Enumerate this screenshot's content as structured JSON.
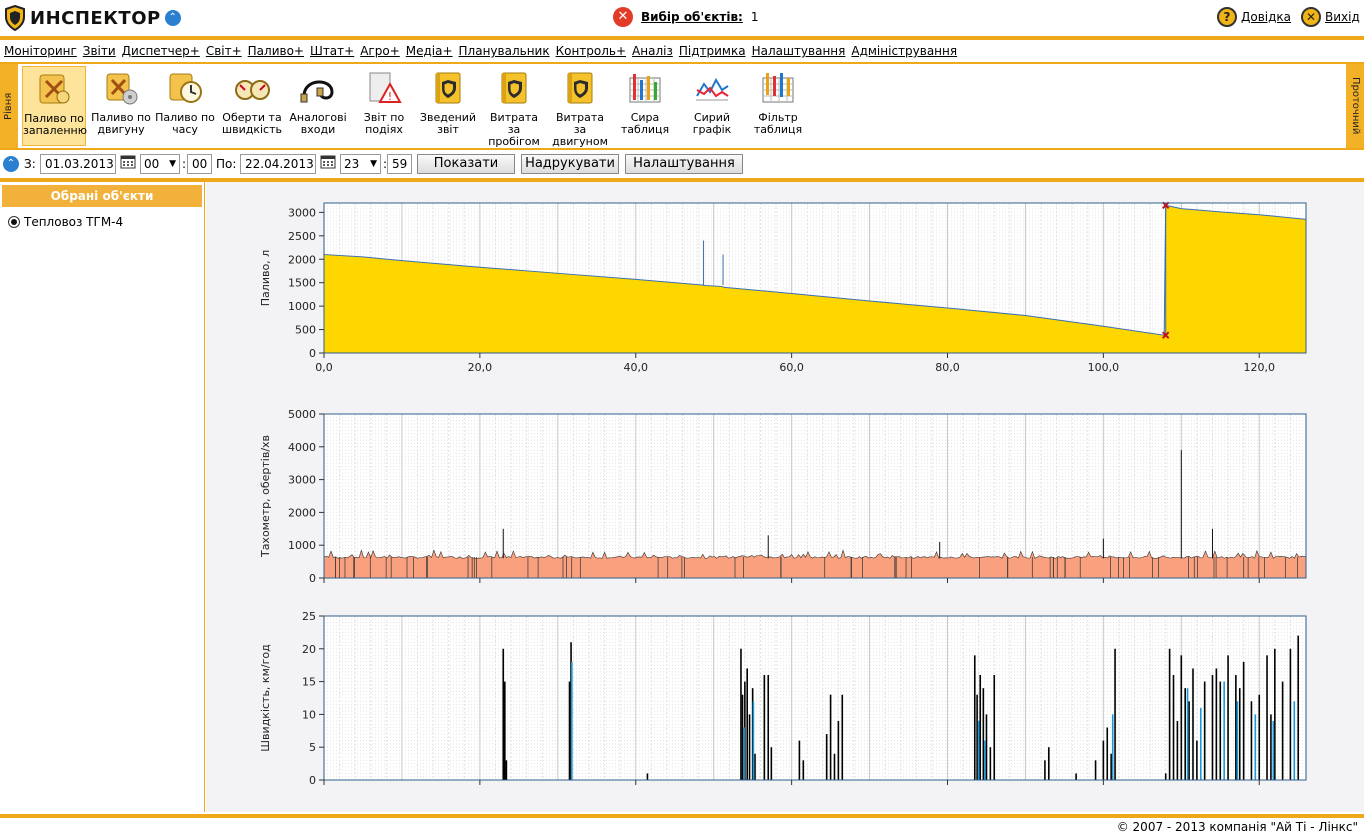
{
  "header": {
    "logo_text": "ИНСПЕКТОР",
    "object_selection_label": "Вибір об'єктів:",
    "object_selection_count": "1",
    "help_label": "Довідка",
    "exit_label": "Вихід"
  },
  "menu": [
    "Моніторинг",
    "Звіти",
    "Диспетчер+",
    "Світ+",
    "Паливо+",
    "Штат+",
    "Агро+",
    "Медіа+",
    "Планувальник",
    "Контроль+",
    "Аналіз",
    "Підтримка",
    "Налаштування",
    "Адміністрування"
  ],
  "toolbar": {
    "left_tab": "Рівня",
    "right_tab": "Проточний",
    "tools": [
      {
        "l1": "Паливо по",
        "l2": "запаленню",
        "icon": "fuel-ignition-icon",
        "active": true
      },
      {
        "l1": "Паливо по",
        "l2": "двигуну",
        "icon": "fuel-engine-icon",
        "active": false
      },
      {
        "l1": "Паливо по",
        "l2": "часу",
        "icon": "fuel-time-icon",
        "active": false
      },
      {
        "l1": "Оберти та",
        "l2": "швидкість",
        "icon": "gauges-icon",
        "active": false
      },
      {
        "l1": "Аналогові",
        "l2": "входи",
        "icon": "cable-icon",
        "active": false
      },
      {
        "l1": "Звіт по",
        "l2": "подіях",
        "icon": "warning-report-icon",
        "active": false
      },
      {
        "l1": "Зведений",
        "l2": "звіт",
        "icon": "summary-report-icon",
        "active": false
      },
      {
        "l1": "Витрата за",
        "l2": "пробігом",
        "icon": "mileage-consumption-icon",
        "active": false
      },
      {
        "l1": "Витрата за",
        "l2": "двигуном",
        "icon": "engine-consumption-icon",
        "active": false
      },
      {
        "l1": "Сира",
        "l2": "таблиця",
        "icon": "raw-table-icon",
        "active": false
      },
      {
        "l1": "Сирий",
        "l2": "графік",
        "icon": "raw-chart-icon",
        "active": false
      },
      {
        "l1": "Фільтр",
        "l2": "таблиця",
        "icon": "filter-table-icon",
        "active": false
      }
    ]
  },
  "filter": {
    "from_label": "З:",
    "from_date": "01.03.2013",
    "from_hour": "00",
    "from_min": "00",
    "to_label": "По:",
    "to_date": "22.04.2013",
    "to_hour": "23",
    "to_min": "59",
    "show_btn": "Показати",
    "print_btn": "Надрукувати",
    "settings_btn": "Налаштування"
  },
  "left_panel": {
    "title": "Обрані об'єкти",
    "items": [
      "Тепловоз ТГМ-4"
    ]
  },
  "colors": {
    "accent": "#f0a81b",
    "fuel_fill": "#ffd700",
    "tacho_fill": "#f9a07e",
    "speed_black": "#000000",
    "speed_blue": "#1a9ad6"
  },
  "chart_data": [
    {
      "type": "area",
      "ylabel": "Паливо, л",
      "xlabel": "",
      "ylim": [
        0,
        3200
      ],
      "yticks": [
        "0",
        "500",
        "1000",
        "1500",
        "2000",
        "2500",
        "3000"
      ],
      "yticks_values": [
        0,
        500,
        1000,
        1500,
        2000,
        2500,
        3000
      ],
      "xlim": [
        0,
        126
      ],
      "xticks": [
        "0,0",
        "20,0",
        "40,0",
        "60,0",
        "80,0",
        "100,0",
        "120,0"
      ],
      "xticks_values": [
        0,
        20,
        40,
        60,
        80,
        100,
        120
      ],
      "series": [
        {
          "x": [
            0,
            5,
            10,
            20,
            30,
            40,
            48.5,
            48.7,
            48.9,
            51,
            51.2,
            51.4,
            60,
            70,
            80,
            90,
            100,
            107.8,
            108.0,
            110,
            115,
            120,
            126
          ],
          "y": [
            2100,
            2050,
            1970,
            1830,
            1700,
            1570,
            1450,
            2400,
            1440,
            1420,
            2100,
            1400,
            1270,
            1110,
            960,
            800,
            570,
            380,
            3150,
            3080,
            3010,
            2950,
            2850
          ]
        }
      ],
      "markers": [
        {
          "x": 108,
          "y": 3150
        },
        {
          "x": 108,
          "y": 380
        }
      ]
    },
    {
      "type": "area",
      "ylabel": "Тахометр, обертів/хв",
      "xlabel": "",
      "ylim": [
        0,
        5000
      ],
      "yticks": [
        "0",
        "1000",
        "2000",
        "3000",
        "4000",
        "5000"
      ],
      "yticks_values": [
        0,
        1000,
        2000,
        3000,
        4000,
        5000
      ],
      "xlim": [
        0,
        126
      ],
      "baseline": 600,
      "spikes": [
        {
          "x": 23,
          "y": 1500
        },
        {
          "x": 57,
          "y": 1300
        },
        {
          "x": 79,
          "y": 1100
        },
        {
          "x": 110,
          "y": 3900
        },
        {
          "x": 114,
          "y": 1500
        },
        {
          "x": 100,
          "y": 1200
        }
      ]
    },
    {
      "type": "bar",
      "ylabel": "Швидкість, км/год",
      "xlabel": "",
      "ylim": [
        0,
        25
      ],
      "yticks": [
        "0",
        "5",
        "10",
        "15",
        "20",
        "25"
      ],
      "yticks_values": [
        0,
        5,
        10,
        15,
        20,
        25
      ],
      "xlim": [
        0,
        126
      ],
      "series": [
        {
          "name": "",
          "color": "#000000",
          "x": [
            23.0,
            23.2,
            23.4,
            31.5,
            31.7,
            41.5,
            53.5,
            53.7,
            54.0,
            54.3,
            54.6,
            55.0,
            55.3,
            56.5,
            57.0,
            57.4,
            61.0,
            61.5,
            64.5,
            65.0,
            65.5,
            66.0,
            66.5,
            83.5,
            83.8,
            84.2,
            84.6,
            85.0,
            85.5,
            86.0,
            92.5,
            93.0,
            96.5,
            99.0,
            100.0,
            100.5,
            101.0,
            101.5,
            108.0,
            108.5,
            109.0,
            109.5,
            110.0,
            110.5,
            111.0,
            111.5,
            112.0,
            113.0,
            114.0,
            114.5,
            115.0,
            116.0,
            117.0,
            117.5,
            118.0,
            119.0,
            120.0,
            121.0,
            121.5,
            122.0,
            123.0,
            124.0,
            125.0
          ],
          "y": [
            20,
            15,
            3,
            15,
            21,
            1,
            20,
            13,
            15,
            17,
            10,
            14,
            4,
            16,
            16,
            5,
            6,
            3,
            7,
            13,
            4,
            9,
            13,
            19,
            13,
            16,
            14,
            10,
            5,
            16,
            3,
            5,
            1,
            3,
            6,
            8,
            4,
            20,
            1,
            20,
            16,
            9,
            19,
            14,
            12,
            17,
            6,
            15,
            16,
            17,
            15,
            19,
            16,
            14,
            18,
            12,
            13,
            19,
            10,
            20,
            15,
            20,
            22
          ]
        },
        {
          "name": "",
          "color": "#1a9ad6",
          "x": [
            31.8,
            53.9,
            55.1,
            84.0,
            84.8,
            101.2,
            110.8,
            112.5,
            115.5,
            117.2,
            119.5,
            121.8,
            124.5
          ],
          "y": [
            18,
            8,
            12,
            9,
            6,
            10,
            14,
            11,
            15,
            12,
            10,
            9,
            12
          ]
        }
      ]
    }
  ],
  "footer": "© 2007 - 2013 компанія \"Ай Ті - Лінкс\""
}
